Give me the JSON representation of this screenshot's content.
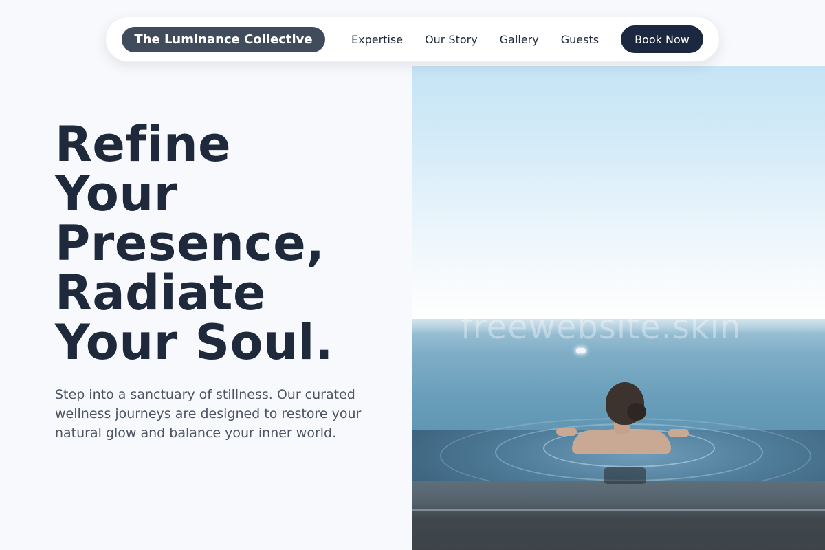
{
  "nav": {
    "brand": "The Luminance Collective",
    "links": [
      "Expertise",
      "Our Story",
      "Gallery",
      "Guests"
    ],
    "cta": "Book Now"
  },
  "hero": {
    "title_lines": [
      "Refine",
      "Your",
      "Presence,",
      "Radiate",
      "Your Soul."
    ],
    "subtitle": "Step into a sanctuary of stillness. Our curated wellness journeys are designed to restore your natural glow and balance your inner world.",
    "image": {
      "subject": "woman-in-infinity-pool-facing-sea",
      "watermark": "freewebsite.skin"
    }
  },
  "colors": {
    "background": "#f8f9fc",
    "brand_pill": "#404b5b",
    "cta": "#1c2740",
    "heading": "#1e293b",
    "body_text": "#4b5563"
  }
}
